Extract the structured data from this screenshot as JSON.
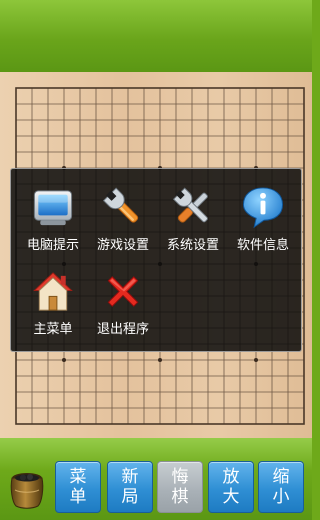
{
  "menu": {
    "items": [
      {
        "label": "电脑提示",
        "icon": "computer-monitor-icon"
      },
      {
        "label": "游戏设置",
        "icon": "wrench-icon"
      },
      {
        "label": "系统设置",
        "icon": "tools-icon"
      },
      {
        "label": "软件信息",
        "icon": "info-icon"
      },
      {
        "label": "主菜单",
        "icon": "home-icon"
      },
      {
        "label": "退出程序",
        "icon": "close-x-icon"
      }
    ]
  },
  "controls": [
    {
      "label": "菜单",
      "enabled": true
    },
    {
      "label": "新局",
      "enabled": true
    },
    {
      "label": "悔棋",
      "enabled": false
    },
    {
      "label": "放大",
      "enabled": true
    },
    {
      "label": "缩小",
      "enabled": true
    }
  ],
  "colors": {
    "green": "#6ea91a",
    "board": "#e6c6a2",
    "button_blue": "#2f8fd4",
    "button_disabled": "#a8b0b6",
    "panel": "#0c0c0c"
  }
}
